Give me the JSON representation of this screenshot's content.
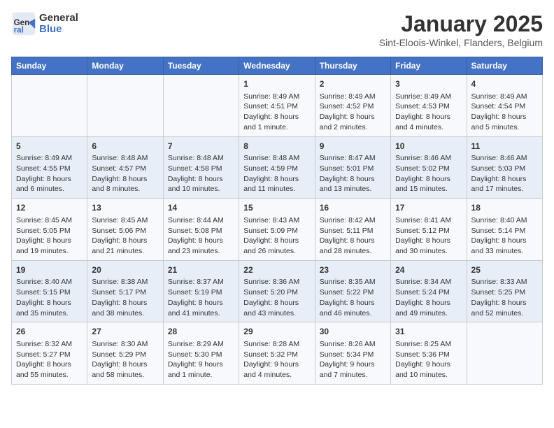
{
  "header": {
    "logo_general": "General",
    "logo_blue": "Blue",
    "month_title": "January 2025",
    "subtitle": "Sint-Eloois-Winkel, Flanders, Belgium"
  },
  "weekdays": [
    "Sunday",
    "Monday",
    "Tuesday",
    "Wednesday",
    "Thursday",
    "Friday",
    "Saturday"
  ],
  "weeks": [
    [
      {
        "day": "",
        "info": ""
      },
      {
        "day": "",
        "info": ""
      },
      {
        "day": "",
        "info": ""
      },
      {
        "day": "1",
        "info": "Sunrise: 8:49 AM\nSunset: 4:51 PM\nDaylight: 8 hours and 1 minute."
      },
      {
        "day": "2",
        "info": "Sunrise: 8:49 AM\nSunset: 4:52 PM\nDaylight: 8 hours and 2 minutes."
      },
      {
        "day": "3",
        "info": "Sunrise: 8:49 AM\nSunset: 4:53 PM\nDaylight: 8 hours and 4 minutes."
      },
      {
        "day": "4",
        "info": "Sunrise: 8:49 AM\nSunset: 4:54 PM\nDaylight: 8 hours and 5 minutes."
      }
    ],
    [
      {
        "day": "5",
        "info": "Sunrise: 8:49 AM\nSunset: 4:55 PM\nDaylight: 8 hours and 6 minutes."
      },
      {
        "day": "6",
        "info": "Sunrise: 8:48 AM\nSunset: 4:57 PM\nDaylight: 8 hours and 8 minutes."
      },
      {
        "day": "7",
        "info": "Sunrise: 8:48 AM\nSunset: 4:58 PM\nDaylight: 8 hours and 10 minutes."
      },
      {
        "day": "8",
        "info": "Sunrise: 8:48 AM\nSunset: 4:59 PM\nDaylight: 8 hours and 11 minutes."
      },
      {
        "day": "9",
        "info": "Sunrise: 8:47 AM\nSunset: 5:01 PM\nDaylight: 8 hours and 13 minutes."
      },
      {
        "day": "10",
        "info": "Sunrise: 8:46 AM\nSunset: 5:02 PM\nDaylight: 8 hours and 15 minutes."
      },
      {
        "day": "11",
        "info": "Sunrise: 8:46 AM\nSunset: 5:03 PM\nDaylight: 8 hours and 17 minutes."
      }
    ],
    [
      {
        "day": "12",
        "info": "Sunrise: 8:45 AM\nSunset: 5:05 PM\nDaylight: 8 hours and 19 minutes."
      },
      {
        "day": "13",
        "info": "Sunrise: 8:45 AM\nSunset: 5:06 PM\nDaylight: 8 hours and 21 minutes."
      },
      {
        "day": "14",
        "info": "Sunrise: 8:44 AM\nSunset: 5:08 PM\nDaylight: 8 hours and 23 minutes."
      },
      {
        "day": "15",
        "info": "Sunrise: 8:43 AM\nSunset: 5:09 PM\nDaylight: 8 hours and 26 minutes."
      },
      {
        "day": "16",
        "info": "Sunrise: 8:42 AM\nSunset: 5:11 PM\nDaylight: 8 hours and 28 minutes."
      },
      {
        "day": "17",
        "info": "Sunrise: 8:41 AM\nSunset: 5:12 PM\nDaylight: 8 hours and 30 minutes."
      },
      {
        "day": "18",
        "info": "Sunrise: 8:40 AM\nSunset: 5:14 PM\nDaylight: 8 hours and 33 minutes."
      }
    ],
    [
      {
        "day": "19",
        "info": "Sunrise: 8:40 AM\nSunset: 5:15 PM\nDaylight: 8 hours and 35 minutes."
      },
      {
        "day": "20",
        "info": "Sunrise: 8:38 AM\nSunset: 5:17 PM\nDaylight: 8 hours and 38 minutes."
      },
      {
        "day": "21",
        "info": "Sunrise: 8:37 AM\nSunset: 5:19 PM\nDaylight: 8 hours and 41 minutes."
      },
      {
        "day": "22",
        "info": "Sunrise: 8:36 AM\nSunset: 5:20 PM\nDaylight: 8 hours and 43 minutes."
      },
      {
        "day": "23",
        "info": "Sunrise: 8:35 AM\nSunset: 5:22 PM\nDaylight: 8 hours and 46 minutes."
      },
      {
        "day": "24",
        "info": "Sunrise: 8:34 AM\nSunset: 5:24 PM\nDaylight: 8 hours and 49 minutes."
      },
      {
        "day": "25",
        "info": "Sunrise: 8:33 AM\nSunset: 5:25 PM\nDaylight: 8 hours and 52 minutes."
      }
    ],
    [
      {
        "day": "26",
        "info": "Sunrise: 8:32 AM\nSunset: 5:27 PM\nDaylight: 8 hours and 55 minutes."
      },
      {
        "day": "27",
        "info": "Sunrise: 8:30 AM\nSunset: 5:29 PM\nDaylight: 8 hours and 58 minutes."
      },
      {
        "day": "28",
        "info": "Sunrise: 8:29 AM\nSunset: 5:30 PM\nDaylight: 9 hours and 1 minute."
      },
      {
        "day": "29",
        "info": "Sunrise: 8:28 AM\nSunset: 5:32 PM\nDaylight: 9 hours and 4 minutes."
      },
      {
        "day": "30",
        "info": "Sunrise: 8:26 AM\nSunset: 5:34 PM\nDaylight: 9 hours and 7 minutes."
      },
      {
        "day": "31",
        "info": "Sunrise: 8:25 AM\nSunset: 5:36 PM\nDaylight: 9 hours and 10 minutes."
      },
      {
        "day": "",
        "info": ""
      }
    ]
  ]
}
